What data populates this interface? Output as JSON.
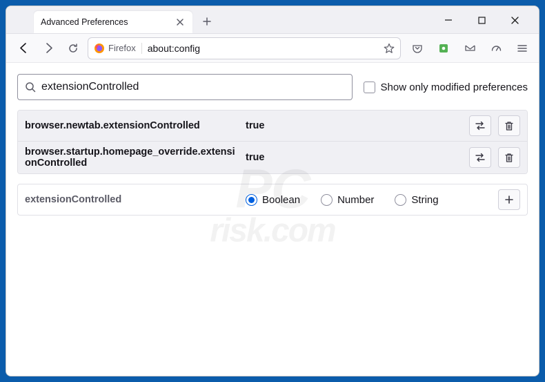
{
  "tab": {
    "title": "Advanced Preferences"
  },
  "urlbar": {
    "brand": "Firefox",
    "url": "about:config"
  },
  "search": {
    "value": "extensionControlled",
    "checkbox_label": "Show only modified preferences"
  },
  "prefs": [
    {
      "name": "browser.newtab.extensionControlled",
      "value": "true"
    },
    {
      "name": "browser.startup.homepage_override.extensionControlled",
      "value": "true"
    }
  ],
  "newpref": {
    "name": "extensionControlled",
    "types": {
      "boolean": "Boolean",
      "number": "Number",
      "string": "String"
    },
    "selected": "boolean"
  },
  "watermark": {
    "line1": "PC",
    "line2": "risk.com"
  }
}
